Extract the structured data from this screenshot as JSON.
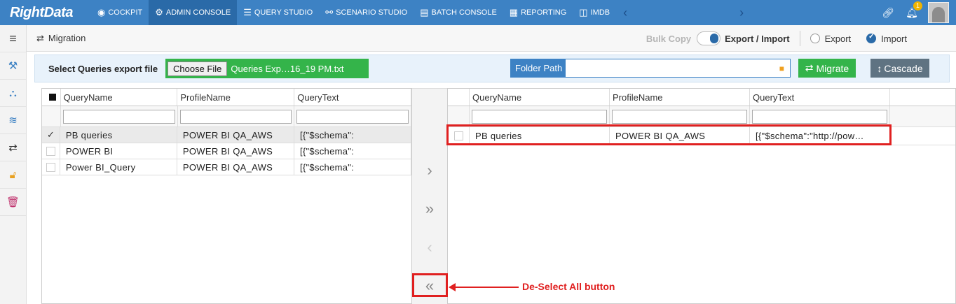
{
  "brand": "RightData",
  "nav": {
    "items": [
      {
        "label": "COCKPIT",
        "icon": "cockpit-icon"
      },
      {
        "label": "ADMIN CONSOLE",
        "icon": "gear-icon"
      },
      {
        "label": "QUERY STUDIO",
        "icon": "database-icon"
      },
      {
        "label": "SCENARIO STUDIO",
        "icon": "scenario-icon"
      },
      {
        "label": "BATCH CONSOLE",
        "icon": "batch-icon"
      },
      {
        "label": "REPORTING",
        "icon": "report-icon"
      },
      {
        "label": "IMDB",
        "icon": "imdb-icon"
      }
    ],
    "notification_count": "1"
  },
  "breadcrumb": "Migration",
  "mode": {
    "bulk_copy": "Bulk Copy",
    "export_import": "Export / Import",
    "export": "Export",
    "import": "Import",
    "selected": "Import"
  },
  "file": {
    "label": "Select Queries export file",
    "choose": "Choose File",
    "filename": "Queries Exp…16_19 PM.txt",
    "folder_label": "Folder Path",
    "folder_value": "",
    "migrate": "Migrate",
    "cascade": "Cascade"
  },
  "columns": [
    "QueryName",
    "ProfileName",
    "QueryText"
  ],
  "left_rows": [
    {
      "name": "PB queries",
      "profile": "POWER BI QA_AWS",
      "text": "[{\"$schema\":",
      "checked": true
    },
    {
      "name": "POWER BI",
      "profile": "POWER BI QA_AWS",
      "text": "[{\"$schema\":",
      "checked": false
    },
    {
      "name": "Power BI_Query",
      "profile": "POWER BI QA_AWS",
      "text": "[{\"$schema\":",
      "checked": false
    }
  ],
  "right_rows": [
    {
      "name": "PB queries",
      "profile": "POWER BI QA_AWS",
      "text": "[{\"$schema\":\"http://pow…",
      "checked": false
    }
  ],
  "annotation": "De-Select All button"
}
